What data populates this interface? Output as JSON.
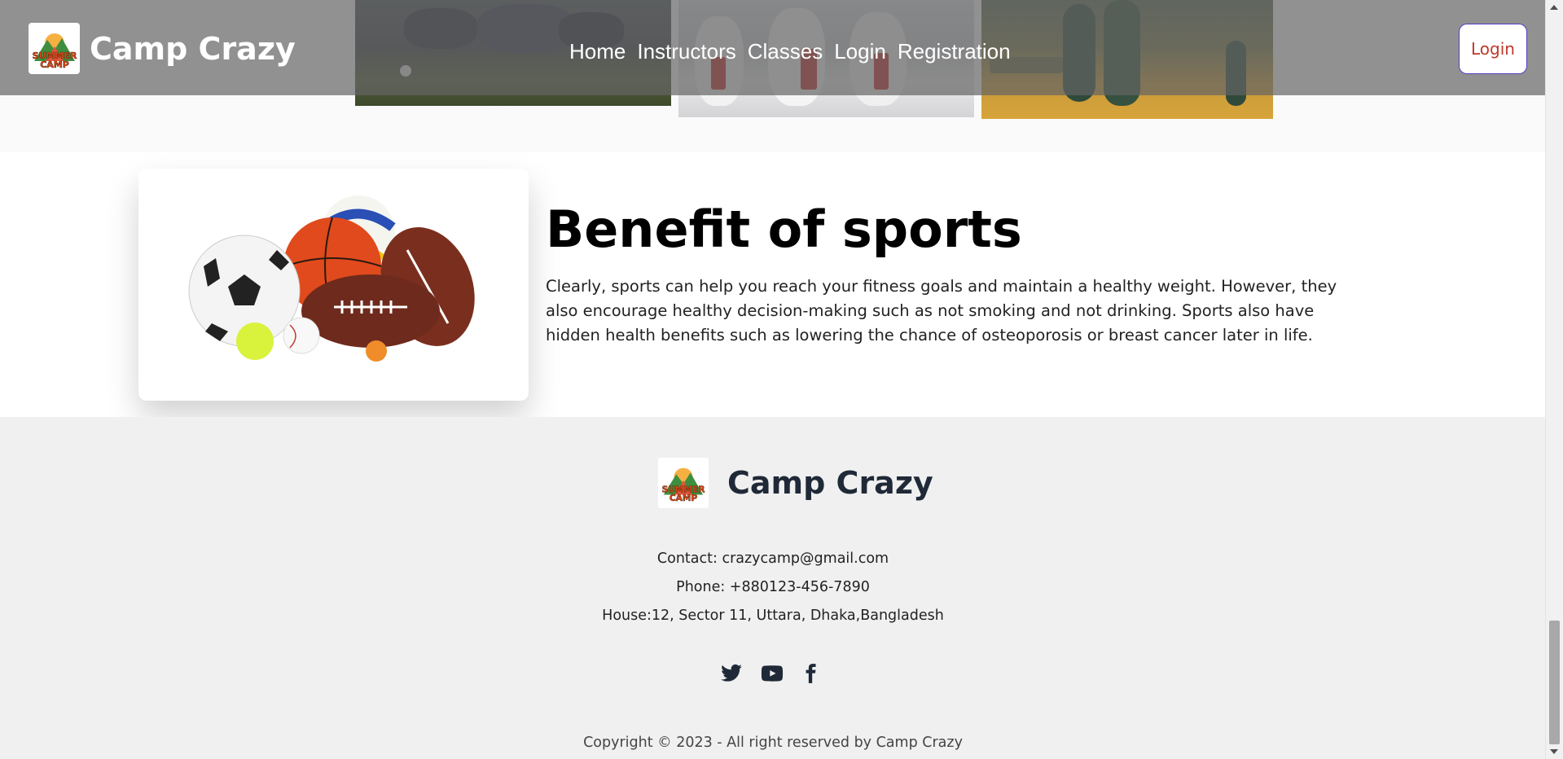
{
  "navbar": {
    "brand": "Camp Crazy",
    "logo_text_1": "SUMMER",
    "logo_text_2": "CAMP",
    "links": [
      "Home",
      "Instructors",
      "Classes",
      "Login",
      "Registration"
    ],
    "login_button": "Login"
  },
  "benefit": {
    "title": "Benefit of sports",
    "text": "Clearly, sports can help you reach your fitness goals and maintain a healthy weight. However, they also encourage healthy decision-making such as not smoking and not drinking. Sports also have hidden health benefits such as lowering the chance of osteoporosis or breast cancer later in life."
  },
  "footer": {
    "brand": "Camp Crazy",
    "contact": "Contact: crazycamp@gmail.com",
    "phone": "Phone: +880123-456-7890",
    "address": "House:12, Sector 11, Uttara, Dhaka,Bangladesh",
    "socials": [
      "twitter-icon",
      "youtube-icon",
      "facebook-icon"
    ],
    "copyright": "Copyright © 2023 - All right reserved by Camp Crazy"
  },
  "colors": {
    "login_text": "#c0392b",
    "login_border": "#5b3cc4",
    "footer_bg": "#f0f0f0",
    "footer_brand": "#1f2937"
  }
}
